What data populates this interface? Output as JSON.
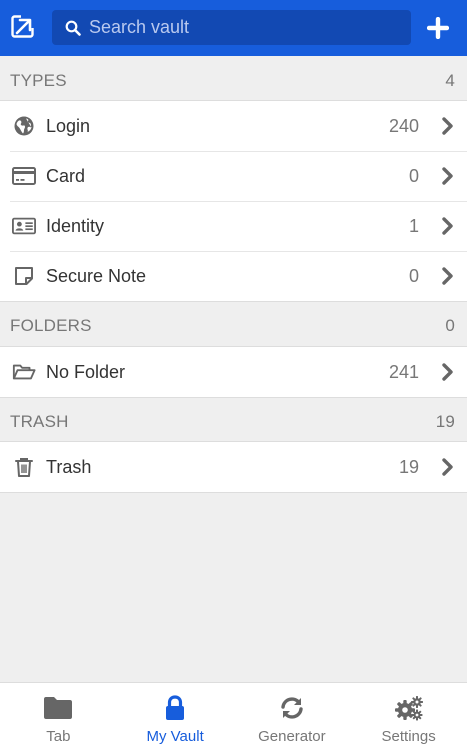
{
  "header": {
    "search_placeholder": "Search vault",
    "popout_icon": "popout-icon",
    "add_icon": "plus-icon"
  },
  "sections": {
    "types": {
      "title": "TYPES",
      "count": "4",
      "items": [
        {
          "label": "Login",
          "count": "240",
          "icon": "globe-icon"
        },
        {
          "label": "Card",
          "count": "0",
          "icon": "credit-card-icon"
        },
        {
          "label": "Identity",
          "count": "1",
          "icon": "id-card-icon"
        },
        {
          "label": "Secure Note",
          "count": "0",
          "icon": "sticky-note-icon"
        }
      ]
    },
    "folders": {
      "title": "FOLDERS",
      "count": "0",
      "items": [
        {
          "label": "No Folder",
          "count": "241",
          "icon": "folder-open-icon"
        }
      ]
    },
    "trash": {
      "title": "TRASH",
      "count": "19",
      "items": [
        {
          "label": "Trash",
          "count": "19",
          "icon": "trash-icon"
        }
      ]
    }
  },
  "bottom_nav": {
    "tabs": [
      {
        "label": "Tab",
        "icon": "folder-icon",
        "active": false
      },
      {
        "label": "My Vault",
        "icon": "lock-icon",
        "active": true
      },
      {
        "label": "Generator",
        "icon": "refresh-icon",
        "active": false
      },
      {
        "label": "Settings",
        "icon": "gears-icon",
        "active": false
      }
    ]
  },
  "colors": {
    "brand": "#175ddc",
    "search_bg": "#1249b3",
    "background": "#efefef",
    "muted_text": "#777777",
    "icon_gray": "#666666"
  }
}
